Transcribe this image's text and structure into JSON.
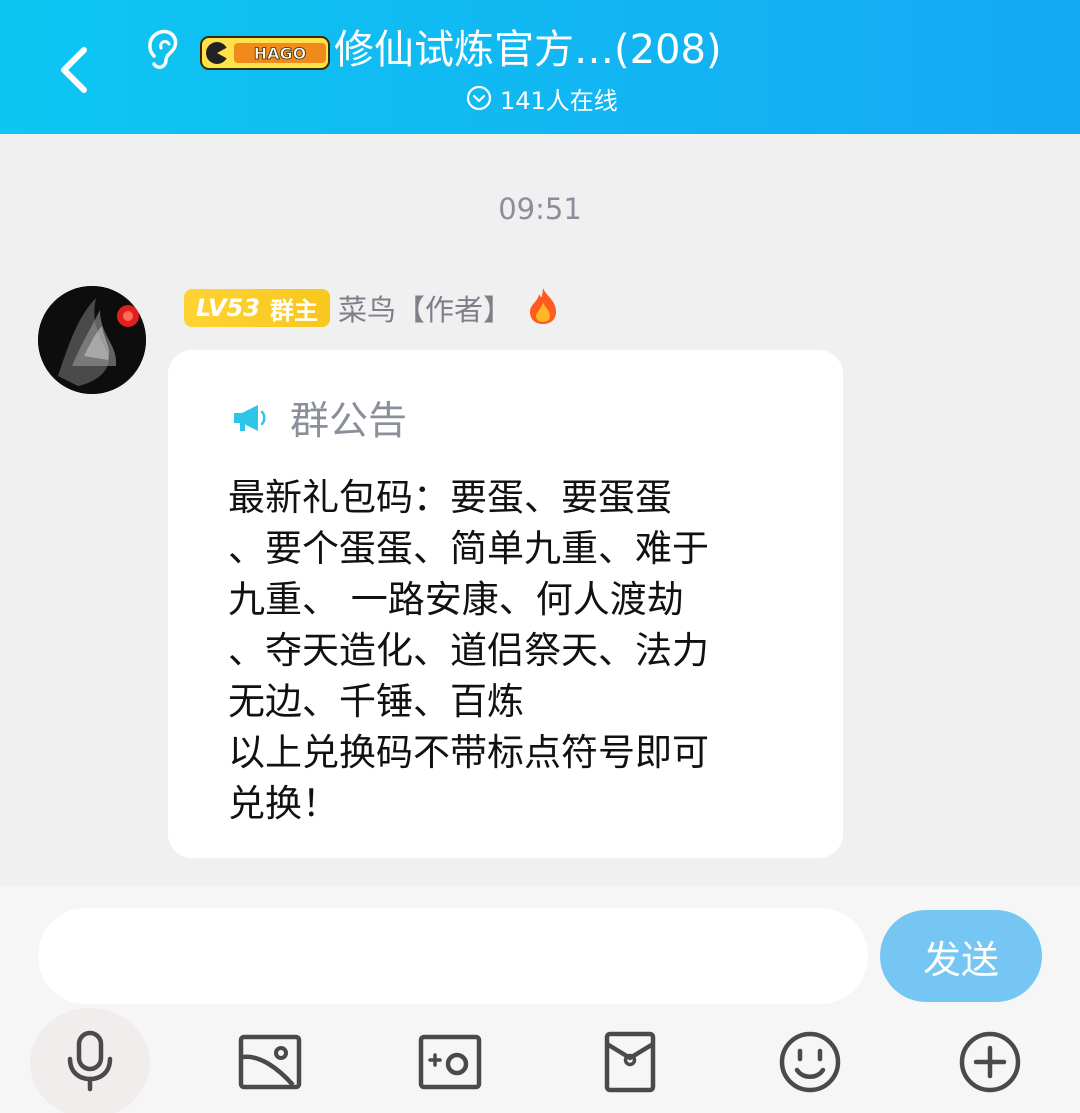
{
  "header": {
    "title": "修仙试炼官方…(208)",
    "online": "141人在线",
    "game_badge": "HAGO"
  },
  "chat": {
    "time": "09:51",
    "message": {
      "level": "LV53",
      "role": "群主",
      "sender": "菜鸟【作者】",
      "notice_title": "群公告",
      "notice_body": "最新礼包码：要蛋、要蛋蛋\n、要个蛋蛋、简单九重、难于\n九重、 一路安康、何人渡劫\n、夺天造化、道侣祭天、法力\n无边、千锤、百炼\n以上兑换码不带标点符号即可\n兑换！"
    }
  },
  "input_bar": {
    "value": "",
    "send_label": "发送"
  },
  "toolbar": {
    "icons": [
      "microphone-icon",
      "image-icon",
      "camera-icon",
      "red-envelope-icon",
      "emoji-icon",
      "plus-icon"
    ]
  },
  "colors": {
    "header_start": "#0ec6f2",
    "header_end": "#14a9f3",
    "send_button": "#75c6f3",
    "level_badge": "#ffd333"
  }
}
